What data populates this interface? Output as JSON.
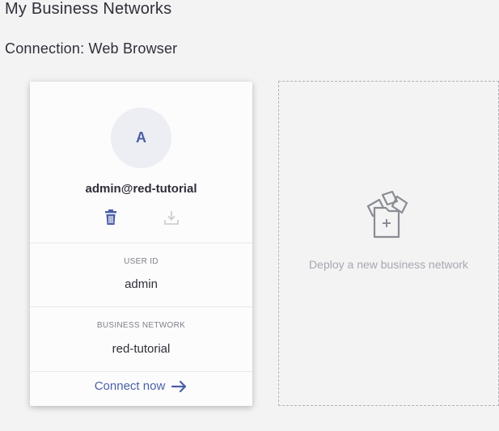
{
  "header": {
    "title": "My Business Networks",
    "connection_label": "Connection: Web Browser"
  },
  "id_card": {
    "avatar_initial": "A",
    "name": "admin@red-tutorial",
    "actions": {
      "delete_icon": "trash-icon",
      "export_icon": "download-icon"
    },
    "user_id_label": "USER ID",
    "user_id_value": "admin",
    "business_network_label": "BUSINESS NETWORK",
    "business_network_value": "red-tutorial",
    "connect_label": "Connect now",
    "connect_icon": "arrow-right-icon"
  },
  "deploy_card": {
    "icon": "deploy-files-icon",
    "label": "Deploy a new business network"
  },
  "colors": {
    "accent": "#4b5fa8",
    "background": "#f3f3f4",
    "muted_text": "#a7a8b0"
  }
}
